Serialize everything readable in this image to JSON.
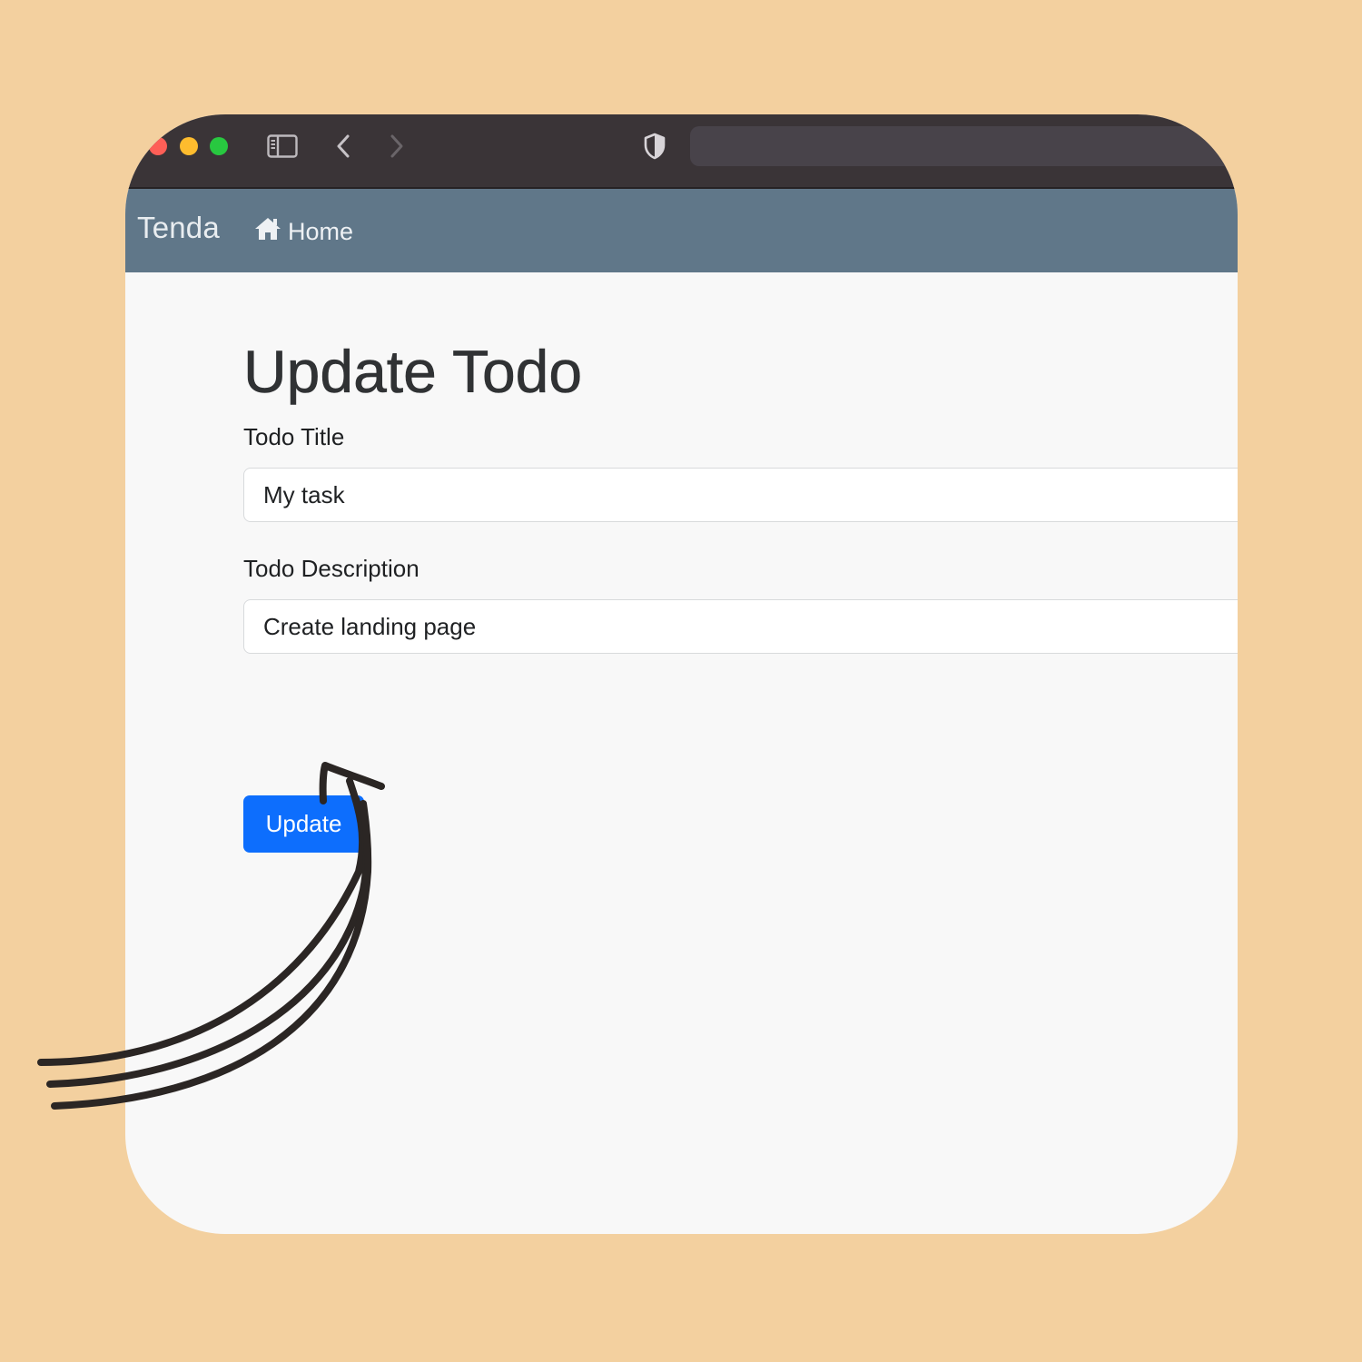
{
  "navbar": {
    "brand": "Tenda",
    "home_label": "Home"
  },
  "browser": {
    "icons": [
      "sidebar-toggle-icon",
      "back-chevron-icon",
      "forward-chevron-icon",
      "shield-icon"
    ]
  },
  "form": {
    "heading": "Update Todo",
    "title_label": "Todo Title",
    "title_value": "My task",
    "description_label": "Todo Description",
    "description_value": "Create landing page",
    "submit_label": "Update"
  },
  "colors": {
    "background": "#f3d09f",
    "titlebar": "#3a3437",
    "navbar": "#607789",
    "primary_button": "#0d6efd"
  }
}
